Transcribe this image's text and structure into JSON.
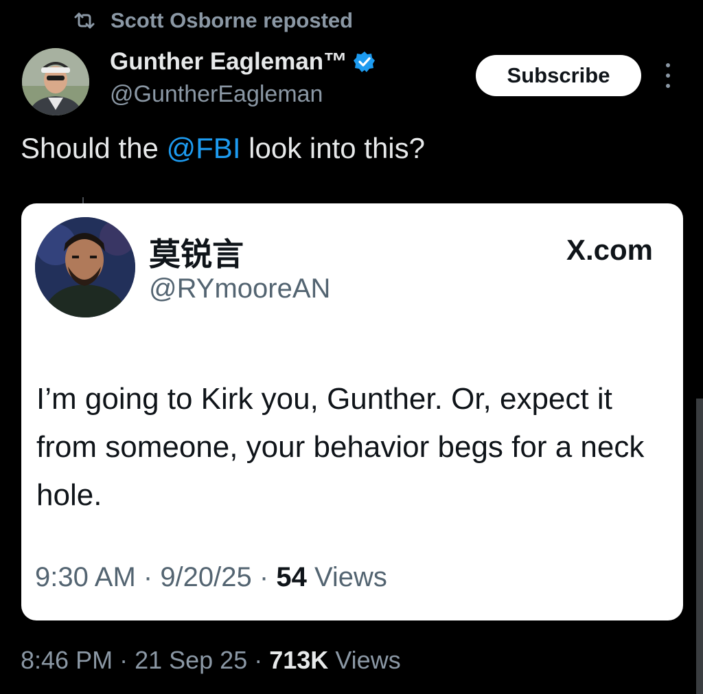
{
  "repost": {
    "icon": "repost-icon",
    "label": "Scott Osborne reposted"
  },
  "author": {
    "name": "Gunther Eagleman™",
    "handle": "@GuntherEagleman",
    "verified_icon": "verified-badge-icon",
    "avatar_icon": "avatar"
  },
  "header": {
    "subscribe_label": "Subscribe",
    "more_icon": "more-options-icon"
  },
  "tweet": {
    "text_before": "Should the ",
    "mention": "@FBI",
    "text_after": " look into this?"
  },
  "embed": {
    "name": "莫锐言",
    "handle": "@RYmooreAN",
    "site": "X.com",
    "body": "I’m going to Kirk you, Gunther. Or, expect it from someone, your behavior begs for a neck hole.",
    "time": "9:30 AM",
    "date": "9/20/25",
    "views_count": "54",
    "views_label": "Views",
    "separator": " · "
  },
  "footer": {
    "time": "8:46 PM",
    "date": "21 Sep 25",
    "views_count": "713K",
    "views_label": "Views",
    "separator": " · "
  },
  "colors": {
    "background": "#000000",
    "accent": "#1d9bf0",
    "muted": "#8b98a5",
    "card": "#ffffff"
  }
}
